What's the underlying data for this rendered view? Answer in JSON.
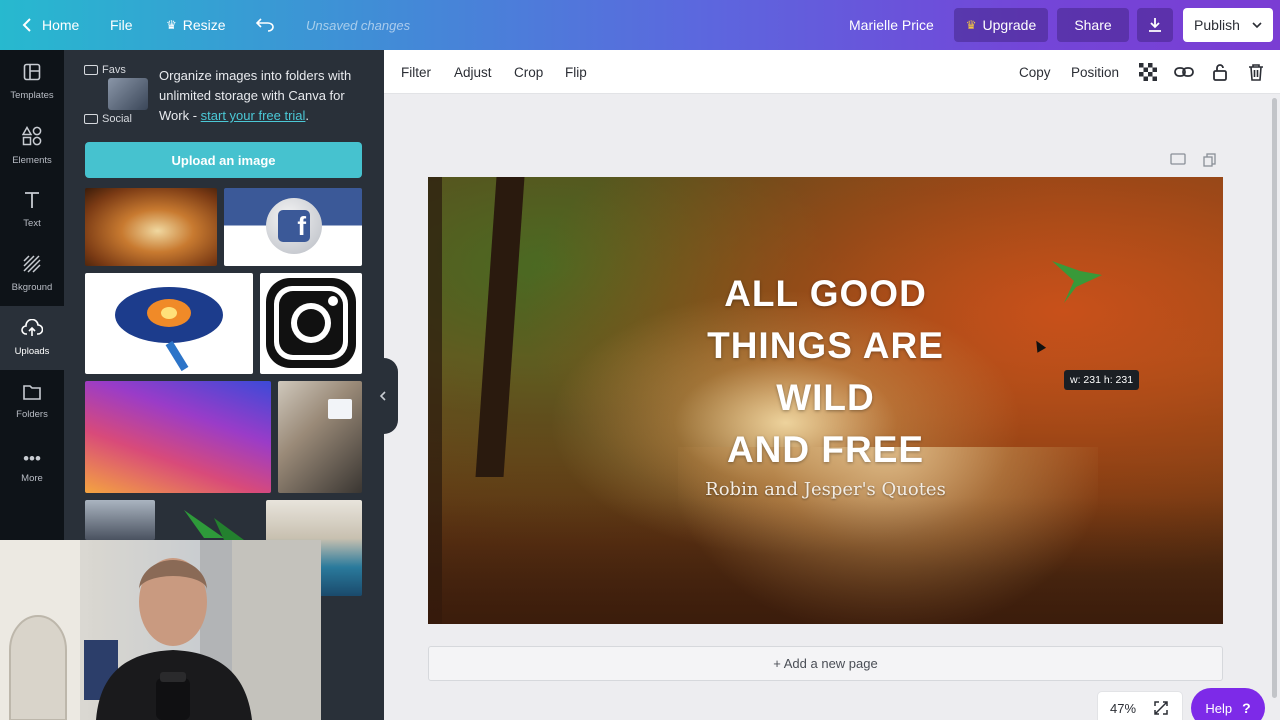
{
  "topbar": {
    "home": "Home",
    "file": "File",
    "resize": "Resize",
    "status": "Unsaved changes",
    "user": "Marielle Price",
    "upgrade": "Upgrade",
    "share": "Share",
    "publish": "Publish"
  },
  "rail": [
    {
      "label": "Templates",
      "icon": "templates-icon"
    },
    {
      "label": "Elements",
      "icon": "elements-icon"
    },
    {
      "label": "Text",
      "icon": "text-icon"
    },
    {
      "label": "Bkground",
      "icon": "background-icon"
    },
    {
      "label": "Uploads",
      "icon": "upload-icon",
      "active": true
    },
    {
      "label": "Folders",
      "icon": "folder-icon"
    },
    {
      "label": "More",
      "icon": "more-icon"
    }
  ],
  "panel": {
    "folders": [
      "Favs",
      "Social"
    ],
    "promo_text": "Organize images into folders with unlimited storage with Canva for Work - ",
    "promo_link": "start your free trial",
    "promo_end": ".",
    "upload_button": "Upload an image"
  },
  "context_toolbar": {
    "filter": "Filter",
    "adjust": "Adjust",
    "crop": "Crop",
    "flip": "Flip",
    "copy": "Copy",
    "position": "Position"
  },
  "design": {
    "quote_lines": [
      "ALL GOOD",
      "THINGS ARE",
      "WILD",
      "AND FREE"
    ],
    "subquote": "Robin and Jesper's Quotes",
    "dimension_tip": "w: 231 h: 231"
  },
  "footer": {
    "add_page": "+ Add a new page",
    "zoom": "47%",
    "help": "Help",
    "help_glyph": "?"
  },
  "colors": {
    "accent_teal": "#46c2cf",
    "help_purple": "#7d2ae8",
    "panel_bg": "#293039",
    "rail_bg": "#0e1318"
  }
}
